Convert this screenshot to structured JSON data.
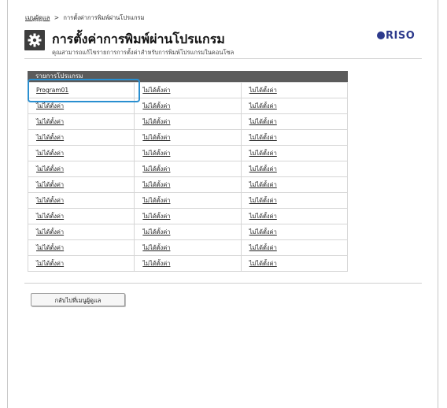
{
  "breadcrumb": {
    "parent": "เมนูผู้ดูแล",
    "separator": ">",
    "current": "การตั้งค่าการพิมพ์ผ่านโปรแกรม"
  },
  "header": {
    "icon": "gear-icon",
    "title": "การตั้งค่าการพิมพ์ผ่านโปรแกรม",
    "subtitle": "คุณสามารถแก้ไขรายการการตั้งค่าสำหรับการพิมพ์โปรแกรมในคอนโซล",
    "logo": "RISO"
  },
  "program_list": {
    "header": "รายการโปรแกรม",
    "rows": [
      [
        "Program01",
        "ไม่ได้ตั้งค่า",
        "ไม่ได้ตั้งค่า"
      ],
      [
        "ไม่ได้ตั้งค่า",
        "ไม่ได้ตั้งค่า",
        "ไม่ได้ตั้งค่า"
      ],
      [
        "ไม่ได้ตั้งค่า",
        "ไม่ได้ตั้งค่า",
        "ไม่ได้ตั้งค่า"
      ],
      [
        "ไม่ได้ตั้งค่า",
        "ไม่ได้ตั้งค่า",
        "ไม่ได้ตั้งค่า"
      ],
      [
        "ไม่ได้ตั้งค่า",
        "ไม่ได้ตั้งค่า",
        "ไม่ได้ตั้งค่า"
      ],
      [
        "ไม่ได้ตั้งค่า",
        "ไม่ได้ตั้งค่า",
        "ไม่ได้ตั้งค่า"
      ],
      [
        "ไม่ได้ตั้งค่า",
        "ไม่ได้ตั้งค่า",
        "ไม่ได้ตั้งค่า"
      ],
      [
        "ไม่ได้ตั้งค่า",
        "ไม่ได้ตั้งค่า",
        "ไม่ได้ตั้งค่า"
      ],
      [
        "ไม่ได้ตั้งค่า",
        "ไม่ได้ตั้งค่า",
        "ไม่ได้ตั้งค่า"
      ],
      [
        "ไม่ได้ตั้งค่า",
        "ไม่ได้ตั้งค่า",
        "ไม่ได้ตั้งค่า"
      ],
      [
        "ไม่ได้ตั้งค่า",
        "ไม่ได้ตั้งค่า",
        "ไม่ได้ตั้งค่า"
      ],
      [
        "ไม่ได้ตั้งค่า",
        "ไม่ได้ตั้งค่า",
        "ไม่ได้ตั้งค่า"
      ]
    ],
    "highlight_color": "#2a8fd0"
  },
  "footer": {
    "back_button_label": "กลับไปที่เมนูผู้ดูแล"
  },
  "colors": {
    "header_bar": "#5b5b5b",
    "logo": "#2d3a8c",
    "selection": "#2a8fd0"
  }
}
